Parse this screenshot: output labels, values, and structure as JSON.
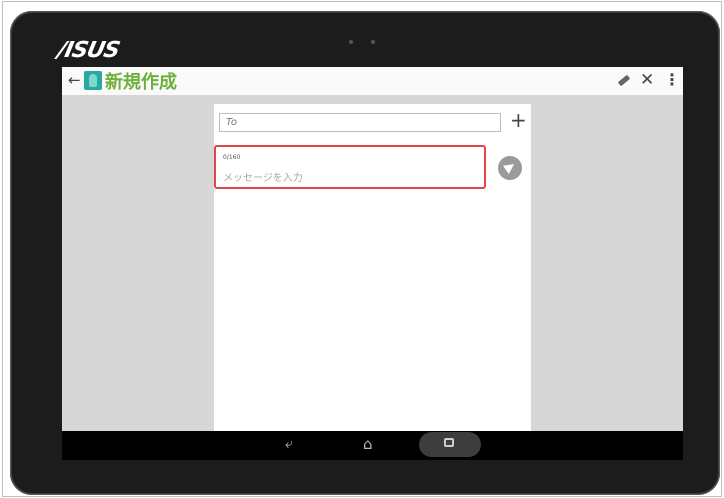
{
  "device": {
    "brand": "/ISUS"
  },
  "app_bar": {
    "back_icon": "arrow-left-icon",
    "title": "新規作成",
    "actions": [
      "pencil-icon",
      "close-icon",
      "overflow-menu-icon"
    ]
  },
  "compose": {
    "to_placeholder": "To",
    "add_recipient_icon": "plus-icon",
    "char_counter": "0/160",
    "message_placeholder": "メッセージを入力",
    "send_icon": "send-icon",
    "highlight_color": "#e2454a"
  },
  "nav_bar": {
    "items": [
      "back-icon",
      "home-icon",
      "recent-apps-icon"
    ]
  }
}
